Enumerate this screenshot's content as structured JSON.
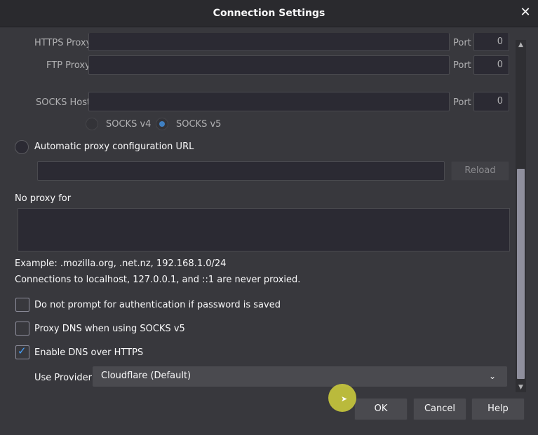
{
  "window": {
    "title": "Connection Settings"
  },
  "proxy": {
    "https_label": "HTTPS Proxy",
    "ftp_label": "FTP Proxy",
    "socks_label": "SOCKS Host",
    "port_label": "Port",
    "https_port": "0",
    "ftp_port": "0",
    "socks_port": "0",
    "socks_v4": "SOCKS v4",
    "socks_v5": "SOCKS v5",
    "socks_version_selected": "SOCKS v5"
  },
  "auto_proxy": {
    "label": "Automatic proxy configuration URL",
    "url_value": "",
    "reload_label": "Reload"
  },
  "no_proxy": {
    "label": "No proxy for",
    "value": "",
    "example": "Example: .mozilla.org, .net.nz, 192.168.1.0/24",
    "note": "Connections to localhost, 127.0.0.1, and ::1 are never proxied."
  },
  "options": {
    "no_prompt_auth": {
      "label": "Do not prompt for authentication if password is saved",
      "checked": false
    },
    "proxy_dns": {
      "label": "Proxy DNS when using SOCKS v5",
      "checked": false
    },
    "doh": {
      "label": "Enable DNS over HTTPS",
      "checked": true
    }
  },
  "provider": {
    "label": "Use Provider",
    "selected": "Cloudflare (Default)"
  },
  "buttons": {
    "ok": "OK",
    "cancel": "Cancel",
    "help": "Help"
  },
  "icons": {
    "close": "close-icon",
    "chevron": "chevron-down-icon",
    "checkmark": "checkmark-icon",
    "scroll_up": "scroll-up-arrow-icon",
    "scroll_down": "scroll-down-arrow-icon",
    "cursor": "mouse-pointer-icon"
  },
  "colors": {
    "accent": "#45a1ff",
    "background": "#38383d",
    "titlebar": "#2a2a2e",
    "cursor_highlight": "#d7d73c"
  }
}
